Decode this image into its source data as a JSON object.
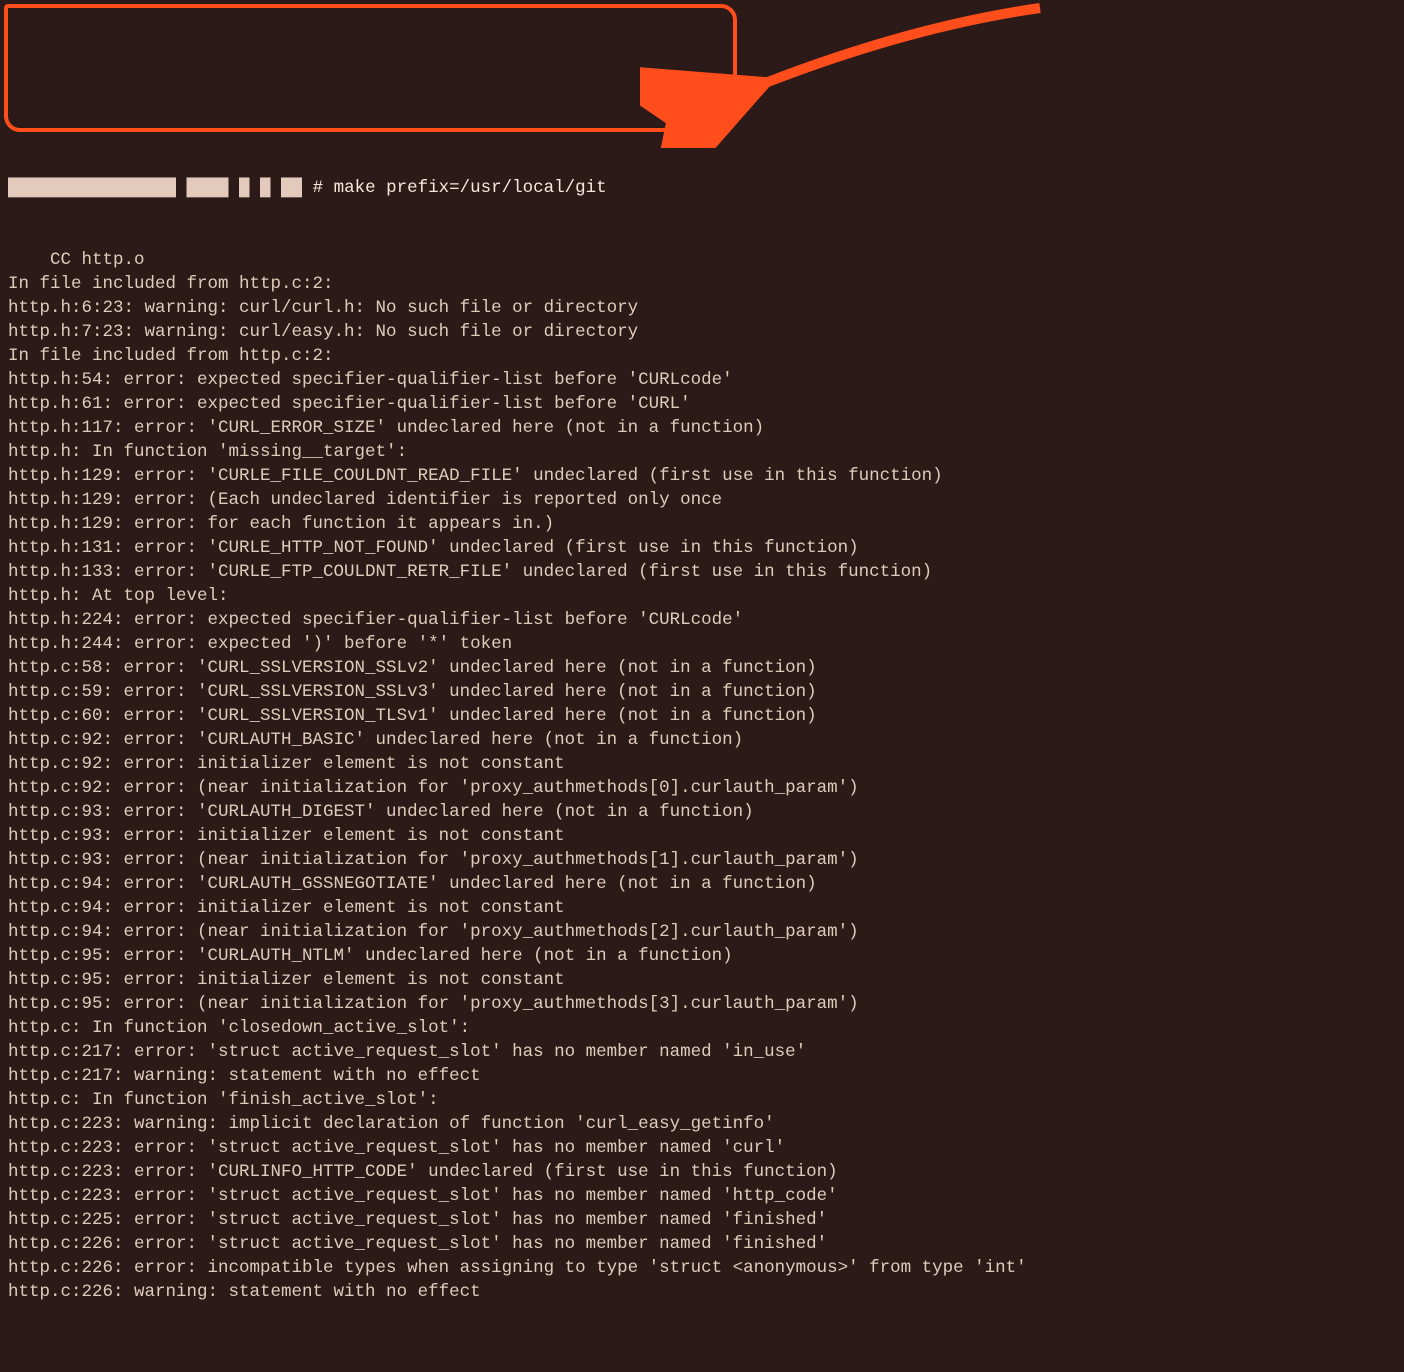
{
  "prompt": {
    "user_host_masked": "████████████████ ████ █ █ ██",
    "symbol": "#",
    "command": "make prefix=/usr/local/git"
  },
  "highlight_color": "#ff4d1c",
  "lines": [
    "    CC http.o",
    "In file included from http.c:2:",
    "http.h:6:23: warning: curl/curl.h: No such file or directory",
    "http.h:7:23: warning: curl/easy.h: No such file or directory",
    "In file included from http.c:2:",
    "http.h:54: error: expected specifier-qualifier-list before 'CURLcode'",
    "http.h:61: error: expected specifier-qualifier-list before 'CURL'",
    "http.h:117: error: 'CURL_ERROR_SIZE' undeclared here (not in a function)",
    "http.h: In function 'missing__target':",
    "http.h:129: error: 'CURLE_FILE_COULDNT_READ_FILE' undeclared (first use in this function)",
    "http.h:129: error: (Each undeclared identifier is reported only once",
    "http.h:129: error: for each function it appears in.)",
    "http.h:131: error: 'CURLE_HTTP_NOT_FOUND' undeclared (first use in this function)",
    "http.h:133: error: 'CURLE_FTP_COULDNT_RETR_FILE' undeclared (first use in this function)",
    "http.h: At top level:",
    "http.h:224: error: expected specifier-qualifier-list before 'CURLcode'",
    "http.h:244: error: expected ')' before '*' token",
    "http.c:58: error: 'CURL_SSLVERSION_SSLv2' undeclared here (not in a function)",
    "http.c:59: error: 'CURL_SSLVERSION_SSLv3' undeclared here (not in a function)",
    "http.c:60: error: 'CURL_SSLVERSION_TLSv1' undeclared here (not in a function)",
    "http.c:92: error: 'CURLAUTH_BASIC' undeclared here (not in a function)",
    "http.c:92: error: initializer element is not constant",
    "http.c:92: error: (near initialization for 'proxy_authmethods[0].curlauth_param')",
    "http.c:93: error: 'CURLAUTH_DIGEST' undeclared here (not in a function)",
    "http.c:93: error: initializer element is not constant",
    "http.c:93: error: (near initialization for 'proxy_authmethods[1].curlauth_param')",
    "http.c:94: error: 'CURLAUTH_GSSNEGOTIATE' undeclared here (not in a function)",
    "http.c:94: error: initializer element is not constant",
    "http.c:94: error: (near initialization for 'proxy_authmethods[2].curlauth_param')",
    "http.c:95: error: 'CURLAUTH_NTLM' undeclared here (not in a function)",
    "http.c:95: error: initializer element is not constant",
    "http.c:95: error: (near initialization for 'proxy_authmethods[3].curlauth_param')",
    "http.c: In function 'closedown_active_slot':",
    "http.c:217: error: 'struct active_request_slot' has no member named 'in_use'",
    "http.c:217: warning: statement with no effect",
    "http.c: In function 'finish_active_slot':",
    "http.c:223: warning: implicit declaration of function 'curl_easy_getinfo'",
    "http.c:223: error: 'struct active_request_slot' has no member named 'curl'",
    "http.c:223: error: 'CURLINFO_HTTP_CODE' undeclared (first use in this function)",
    "http.c:223: error: 'struct active_request_slot' has no member named 'http_code'",
    "http.c:225: error: 'struct active_request_slot' has no member named 'finished'",
    "http.c:226: error: 'struct active_request_slot' has no member named 'finished'",
    "http.c:226: error: incompatible types when assigning to type 'struct <anonymous>' from type 'int'",
    "http.c:226: warning: statement with no effect"
  ]
}
